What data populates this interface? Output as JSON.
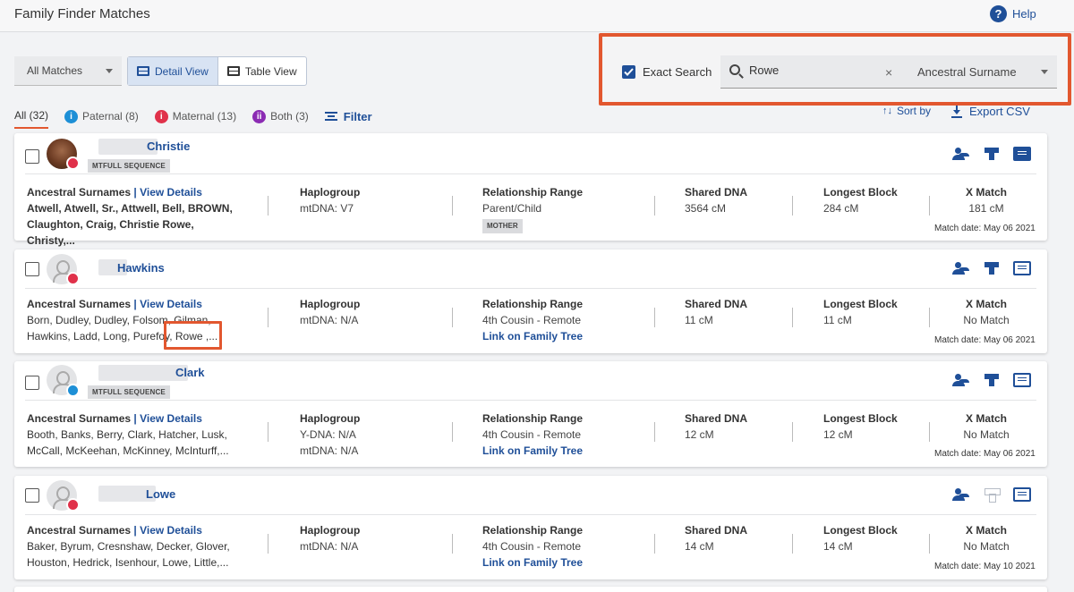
{
  "header": {
    "title": "Family Finder Matches",
    "help_label": "Help"
  },
  "toolbar": {
    "matches_filter": "All Matches",
    "detail_view": "Detail View",
    "table_view": "Table View",
    "exact_search": "Exact Search",
    "search_value": "Rowe",
    "search_clear": "×",
    "search_type": "Ancestral Surname"
  },
  "tabs": {
    "all": "All (32)",
    "paternal": "Paternal (8)",
    "maternal": "Maternal (13)",
    "both": "Both (3)",
    "filter": "Filter",
    "sort_by": "Sort by",
    "export": "Export CSV"
  },
  "labels": {
    "surnames": "Ancestral Surnames",
    "view_details": "| View Details",
    "haplogroup": "Haplogroup",
    "relationship": "Relationship Range",
    "shared_dna": "Shared DNA",
    "longest_block": "Longest Block",
    "x_match": "X Match"
  },
  "matches": [
    {
      "name": "Christie",
      "chip": "MTFULL SEQUENCE",
      "surnames_1": "Atwell, Atwell, Sr., Attwell, Bell, BROWN,",
      "surnames_2": "Claughton, Craig, Christie Rowe, Christy,...",
      "haplo_1": "mtDNA: V7",
      "relationship": "Parent/Child",
      "rel_badge": "MOTHER",
      "shared": "3564 cM",
      "longest": "284 cM",
      "x_match": "181 cM",
      "date": "Match date: May 06 2021"
    },
    {
      "name": "Hawkins",
      "surnames_1": "Born, Dudley, Dudley, Folsom, Gilman,",
      "surnames_2": "Hawkins, Ladd, Long, Purefoy, Rowe ,...",
      "haplo_1": "mtDNA: N/A",
      "relationship": "4th Cousin - Remote",
      "tree_link": "Link on Family Tree",
      "shared": "11 cM",
      "longest": "11 cM",
      "x_match": "No Match",
      "date": "Match date: May 06 2021"
    },
    {
      "name": "Clark",
      "chip": "MTFULL SEQUENCE",
      "surnames_1": "Booth, Banks, Berry, Clark, Hatcher, Lusk,",
      "surnames_2": "McCall, McKeehan, McKinney, McInturff,...",
      "haplo_1": "Y-DNA: N/A",
      "haplo_2": "mtDNA: N/A",
      "relationship": "4th Cousin - Remote",
      "tree_link": "Link on Family Tree",
      "shared": "12 cM",
      "longest": "12 cM",
      "x_match": "No Match",
      "date": "Match date: May 06 2021"
    },
    {
      "name": "Lowe",
      "surnames_1": "Baker, Byrum, Cresnshaw, Decker, Glover,",
      "surnames_2": "Houston, Hedrick, Isenhour, Lowe, Little,...",
      "haplo_1": "mtDNA: N/A",
      "relationship": "4th Cousin - Remote",
      "tree_link": "Link on Family Tree",
      "shared": "14 cM",
      "longest": "14 cM",
      "x_match": "No Match",
      "date": "Match date: May 10 2021"
    }
  ],
  "colors": {
    "accent": "#1f4f98",
    "highlight": "#e2572f",
    "female": "#e0314a",
    "male": "#1d8fd6",
    "both": "#8b2bb3"
  }
}
